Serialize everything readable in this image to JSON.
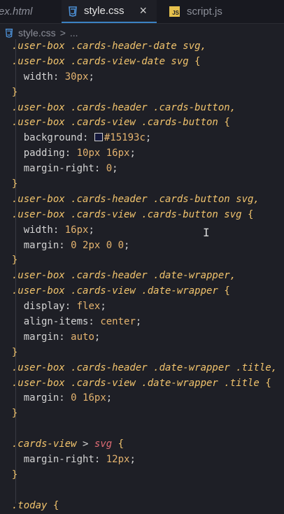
{
  "tabs": [
    {
      "label": "ex.html"
    },
    {
      "label": "style.css",
      "close": "×"
    },
    {
      "label": "script.js"
    }
  ],
  "breadcrumb": {
    "file": "style.css",
    "sep": ">",
    "more": "..."
  },
  "code": {
    "l1": [
      ".user-box .cards-header-date svg,"
    ],
    "l2": [
      ".user-box .cards-view-date svg",
      "{"
    ],
    "l3": [
      "width:",
      "30px",
      ";"
    ],
    "l4": [
      "}"
    ],
    "l5": [
      ".user-box .cards-header .cards-button,"
    ],
    "l6": [
      ".user-box .cards-view .cards-button",
      "{"
    ],
    "l7": [
      "background:",
      "#15193c",
      ";"
    ],
    "l8": [
      "padding:",
      "10px 16px",
      ";"
    ],
    "l9": [
      "margin-right:",
      "0",
      ";"
    ],
    "l10": [
      "}"
    ],
    "l11": [
      ".user-box .cards-header .cards-button svg,"
    ],
    "l12": [
      ".user-box .cards-view .cards-button svg",
      "{"
    ],
    "l13": [
      "width:",
      "16px",
      ";"
    ],
    "l14": [
      "margin:",
      "0 2px 0 0",
      ";"
    ],
    "l15": [
      "}"
    ],
    "l16": [
      ".user-box .cards-header .date-wrapper,"
    ],
    "l17": [
      ".user-box .cards-view .date-wrapper",
      "{"
    ],
    "l18": [
      "display:",
      "flex",
      ";"
    ],
    "l19": [
      "align-items:",
      "center",
      ";"
    ],
    "l20": [
      "margin:",
      "auto",
      ";"
    ],
    "l21": [
      "}"
    ],
    "l22": [
      ".user-box .cards-header .date-wrapper .title,"
    ],
    "l23": [
      ".user-box .cards-view .date-wrapper .title",
      "{"
    ],
    "l24": [
      "margin:",
      "0 16px",
      ";"
    ],
    "l25": [
      "}"
    ],
    "l27": [
      ".cards-view",
      ">",
      "svg",
      "{"
    ],
    "l28": [
      "margin-right:",
      "12px",
      ";"
    ],
    "l29": [
      "}"
    ],
    "l31": [
      ".today",
      "{"
    ]
  },
  "colors": {
    "background": "#1e1f26",
    "selector": "#f2c46d",
    "value": "#e5b46f",
    "tag": "#e06c75"
  }
}
